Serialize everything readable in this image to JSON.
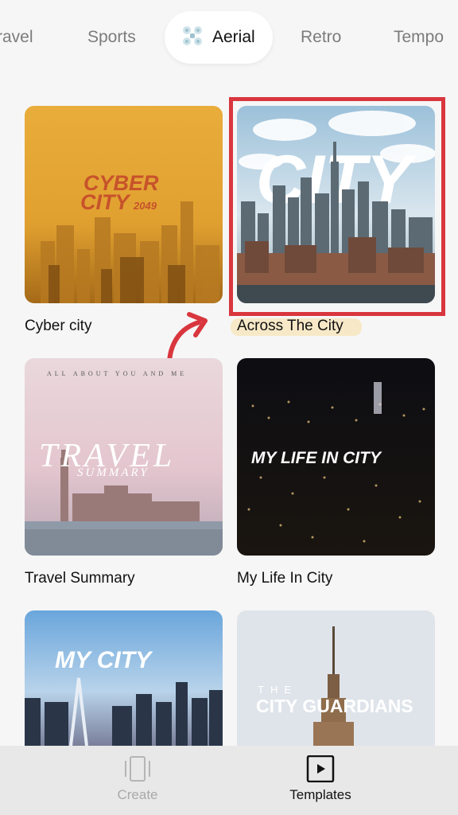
{
  "tabs": [
    {
      "label": "ravel",
      "active": false
    },
    {
      "label": "Sports",
      "active": false
    },
    {
      "label": "Aerial",
      "active": true
    },
    {
      "label": "Retro",
      "active": false
    },
    {
      "label": "Tempo",
      "active": false
    }
  ],
  "icons": {
    "active_tab": "drone-icon",
    "annotation": "red-curved-arrow-icon",
    "create": "phone-frame-icon",
    "templates": "play-square-icon"
  },
  "colors": {
    "highlight": "#d9363e",
    "arrow": "#d9363e"
  },
  "templates": [
    {
      "caption": "Cyber city",
      "overlay_title": "CYBER",
      "overlay_line2": "CITY",
      "overlay_suffix": "2049"
    },
    {
      "caption": "Across The City",
      "overlay_title": "CITY",
      "highlighted": true
    },
    {
      "caption": "Travel Summary",
      "overlay_top": "ALL ABOUT YOU AND ME",
      "overlay_title": "TRAVEL",
      "overlay_sub": "SUMMARY"
    },
    {
      "caption": "My Life In City",
      "overlay_title": "MY LIFE IN CITY"
    },
    {
      "caption": "",
      "overlay_title": "MY CITY"
    },
    {
      "caption": "",
      "overlay_top": "THE",
      "overlay_title": "CITY GUARDIANS"
    }
  ],
  "bottom_nav": {
    "create_label": "Create",
    "templates_label": "Templates"
  }
}
